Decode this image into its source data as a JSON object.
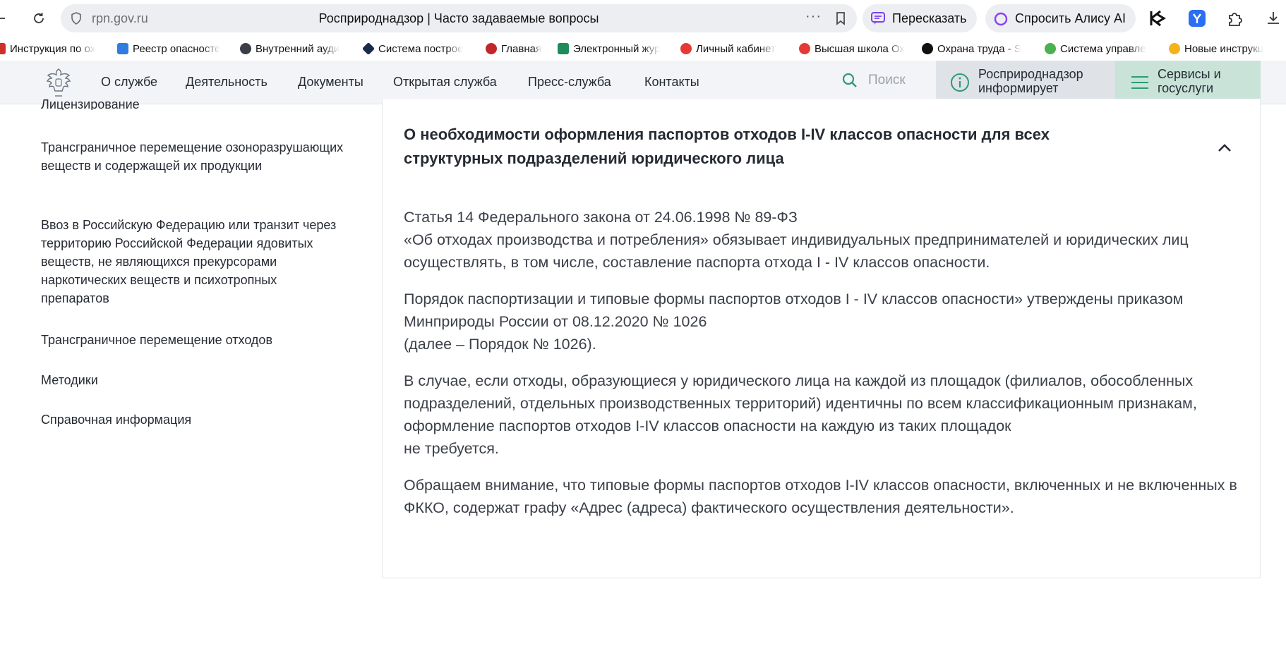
{
  "browser": {
    "domain": "rpn.gov.ru",
    "tab_title": "Росприроднадзор | Часто задаваемые вопросы",
    "dots": "···",
    "retell_label": "Пересказать",
    "alice_label": "Спросить Алису AI"
  },
  "bookmarks": [
    {
      "label": "Инструкция по ох",
      "color": "#d0302a"
    },
    {
      "label": "Реестр опасносте",
      "color": "#2f7de1"
    },
    {
      "label": "Внутренний ауди",
      "color": "#3a3f47"
    },
    {
      "label": "Система построе",
      "color": "#1b2a4a"
    },
    {
      "label": "Главная",
      "color": "#c2262b"
    },
    {
      "label": "Электронный жур",
      "color": "#1f8a5a"
    },
    {
      "label": "Личный кабинет",
      "color": "#e53935"
    },
    {
      "label": "Высшая школа Ох",
      "color": "#e53935"
    },
    {
      "label": "Охрана труда - S",
      "color": "#111111"
    },
    {
      "label": "Система управле",
      "color": "#4caf50"
    },
    {
      "label": "Новые инструкц",
      "color": "#f5b21a"
    }
  ],
  "header": {
    "menu": [
      "О службе",
      "Деятельность",
      "Документы",
      "Открытая служба",
      "Пресс-служба",
      "Контакты"
    ],
    "search_placeholder": "Поиск",
    "inform_label": "Росприроднадзор информирует",
    "services_label": "Сервисы и госуслуги"
  },
  "sidebar": {
    "items": [
      "Лицензирование",
      "Трансграничное перемещение озоноразрушающих веществ и содержащей их продукции",
      "Ввоз в Российскую Федерацию или транзит через территорию Российской Федерации ядовитых веществ, не являющихся прекурсорами наркотических веществ и психотропных препаратов",
      "Трансграничное перемещение отходов",
      "Методики",
      "Справочная информация"
    ]
  },
  "faq": {
    "question": "О необходимости оформления паспортов отходов I-IV классов опасности для всех структурных подразделений юридического лица",
    "p1_l1": "Статья 14 Федерального закона от 24.06.1998 № 89-ФЗ",
    "p1_l2": "«Об отходах производства и потребления» обязывает индивидуальных предпринимателей и юридических лиц осуществлять, в том числе, составление паспорта отхода I - IV классов опасности.",
    "p2_l1": "Порядок паспортизации и типовые формы паспортов отходов I - IV классов опасности» утверждены приказом Минприроды России от 08.12.2020 № 1026",
    "p2_l2": "(далее – Порядок № 1026).",
    "p3_l1": "В случае, если отходы, образующиеся у юридического лица на каждой из площадок (филиалов, обособленных подразделений, отдельных производственных территорий) идентичны по всем классификационным признакам, оформление паспортов отходов I-IV классов опасности на каждую из таких площадок",
    "p3_l2": "не требуется.",
    "p4": "Обращаем внимание, что типовые формы паспортов отходов I-IV классов опасности, включенных и не включенных в ФККО, содержат графу «Адрес (адреса) фактического осуществления деятельности»."
  }
}
